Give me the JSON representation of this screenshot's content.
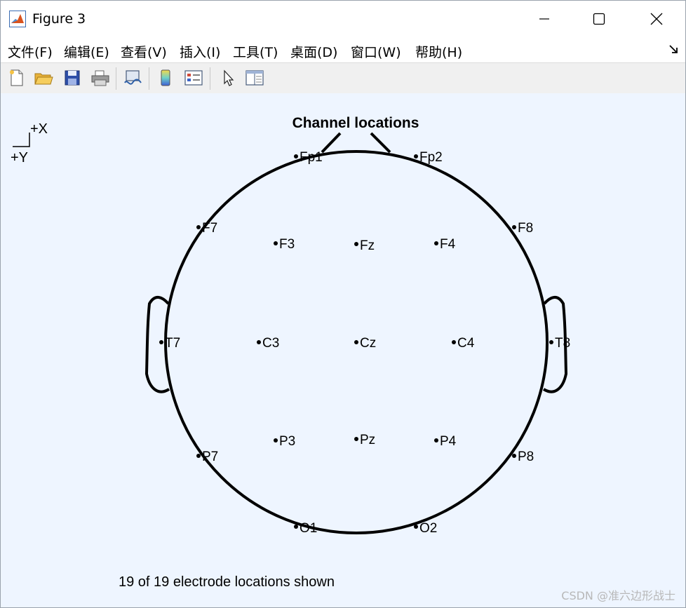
{
  "window": {
    "title": "Figure 3"
  },
  "menu": {
    "items": [
      "文件(F)",
      "编辑(E)",
      "查看(V)",
      "插入(I)",
      "工具(T)",
      "桌面(D)",
      "窗口(W)",
      "帮助(H)"
    ]
  },
  "toolbar": {
    "buttons": [
      {
        "icon": "new-figure-icon"
      },
      {
        "icon": "open-folder-icon"
      },
      {
        "icon": "save-icon"
      },
      {
        "icon": "print-icon"
      },
      {
        "icon": "link-plot-icon"
      },
      {
        "icon": "colorbar-icon"
      },
      {
        "icon": "legend-icon"
      },
      {
        "icon": "pointer-icon"
      },
      {
        "icon": "property-inspector-icon"
      }
    ]
  },
  "figure": {
    "title": "Channel locations",
    "axis_x_label": "+X",
    "axis_y_label": "+Y",
    "footer": "19 of 19 electrode locations shown",
    "electrodes": [
      {
        "label": "Fp1"
      },
      {
        "label": "Fp2"
      },
      {
        "label": "F7"
      },
      {
        "label": "F3"
      },
      {
        "label": "Fz"
      },
      {
        "label": "F4"
      },
      {
        "label": "F8"
      },
      {
        "label": "T7"
      },
      {
        "label": "C3"
      },
      {
        "label": "Cz"
      },
      {
        "label": "C4"
      },
      {
        "label": "T8"
      },
      {
        "label": "P7"
      },
      {
        "label": "P3"
      },
      {
        "label": "Pz"
      },
      {
        "label": "P4"
      },
      {
        "label": "P8"
      },
      {
        "label": "O1"
      },
      {
        "label": "O2"
      }
    ]
  },
  "watermark": "CSDN @准六边形战士"
}
